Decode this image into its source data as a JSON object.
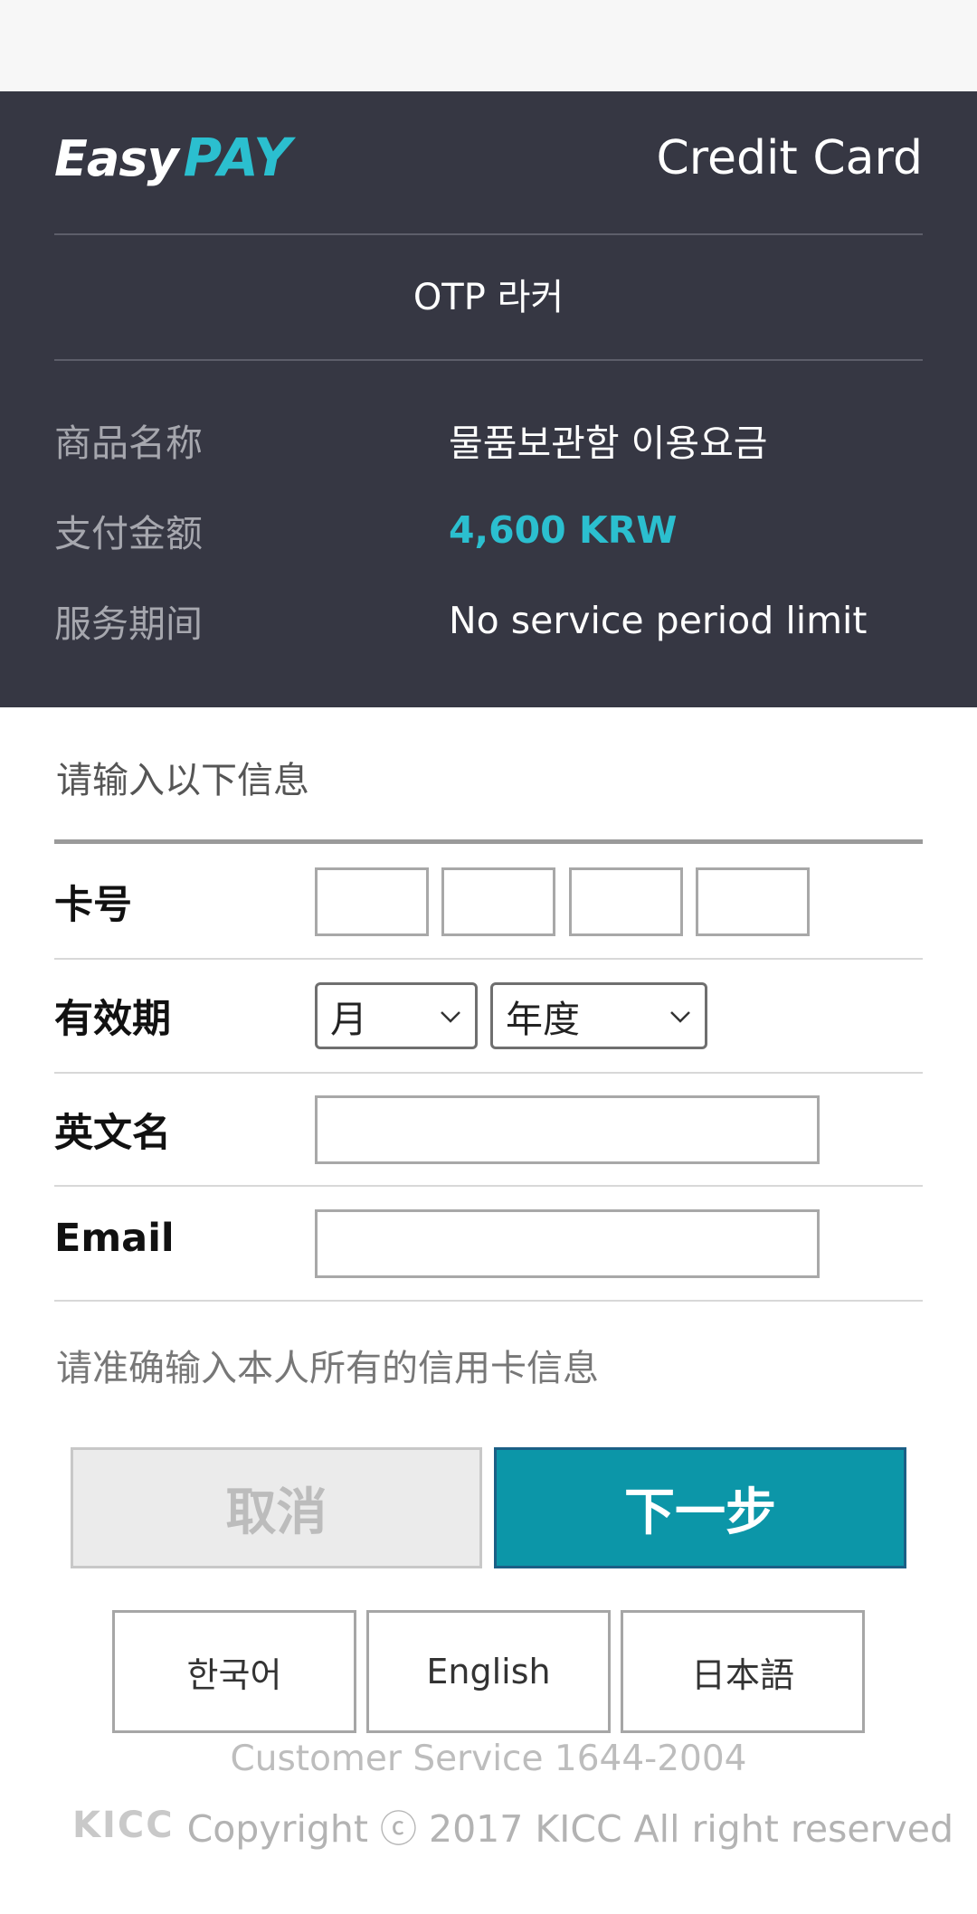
{
  "header": {
    "logo_easy": "Easy",
    "logo_pay": "PAY",
    "title": "Credit Card",
    "merchant": "OTP 라커",
    "rows": [
      {
        "label": "商品名称",
        "value": "물품보관함 이용요금"
      },
      {
        "label": "支付金额",
        "value": "4,600 KRW"
      },
      {
        "label": "服务期间",
        "value": "No service period limit"
      }
    ]
  },
  "form": {
    "prompt": "请输入以下信息",
    "card_number_label": "卡号",
    "expiry_label": "有效期",
    "month_select": "月",
    "year_select": "年度",
    "name_label": "英文名",
    "email_label": "Email",
    "notice": "请准确输入本人所有的信用卡信息"
  },
  "buttons": {
    "cancel": "取消",
    "next": "下一步"
  },
  "languages": [
    "한국어",
    "English",
    "日本語"
  ],
  "footer": {
    "customer_service": "Customer Service 1644-2004",
    "logo": "KICC",
    "copyright": "Copyright ⓒ 2017 KICC All right reserved"
  },
  "colors": {
    "header_bg": "#363743",
    "accent": "#2bbfcf",
    "next_button": "#0c96a8"
  }
}
